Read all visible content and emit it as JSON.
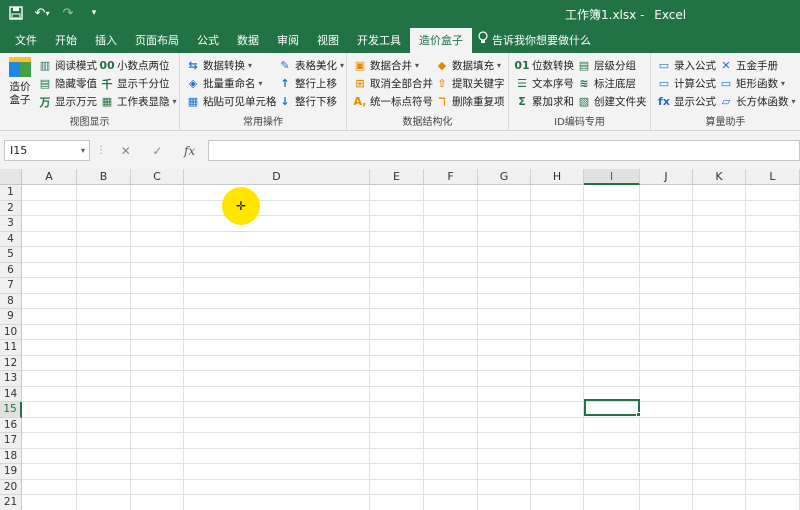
{
  "titlebar": {
    "document": "工作簿1.xlsx",
    "separator": "-",
    "app": "Excel",
    "qat": {
      "save_icon": "save-icon",
      "undo_icon": "undo-icon",
      "redo_icon": "redo-icon",
      "customize_icon": "customize-icon"
    }
  },
  "tabs": [
    "文件",
    "开始",
    "插入",
    "页面布局",
    "公式",
    "数据",
    "审阅",
    "视图",
    "开发工具",
    "造价盒子"
  ],
  "active_tab": "造价盒子",
  "tellme": "告诉我你想要做什么",
  "ribbon": {
    "big_button": {
      "line1": "造价",
      "line2": "盒子"
    },
    "groups": [
      {
        "label": "视图显示",
        "items": [
          "阅读模式",
          "隐藏零值",
          "显示万元",
          "小数点两位",
          "显示千分位",
          "工作表显隐"
        ]
      },
      {
        "label": "常用操作",
        "items": [
          "数据转换",
          "批量重命名",
          "粘贴可见单元格",
          "表格美化",
          "整行上移",
          "整行下移"
        ]
      },
      {
        "label": "数据结构化",
        "items": [
          "数据合并",
          "取消全部合并",
          "统一标点符号",
          "数据填充",
          "提取关键字",
          "删除重复项"
        ]
      },
      {
        "label": "ID编码专用",
        "items": [
          "位数转换",
          "文本序号",
          "累加求和",
          "层级分组",
          "标注底层",
          "创建文件夹"
        ]
      },
      {
        "label": "算量助手",
        "items": [
          "录入公式",
          "计算公式",
          "显示公式",
          "五金手册",
          "矩形函数",
          "长方体函数"
        ]
      }
    ]
  },
  "formula_bar": {
    "name_box": "I15",
    "cancel": "✕",
    "enter": "✓",
    "fx": "fx",
    "formula": ""
  },
  "sheet": {
    "columns": [
      "A",
      "B",
      "C",
      "D",
      "E",
      "F",
      "G",
      "H",
      "I",
      "J",
      "K",
      "L"
    ],
    "rows": [
      "1",
      "2",
      "3",
      "4",
      "5",
      "6",
      "7",
      "8",
      "9",
      "10",
      "11",
      "12",
      "13",
      "14",
      "15",
      "16",
      "17",
      "18",
      "19",
      "20",
      "21"
    ],
    "selected_column": "I",
    "selected_row": "15"
  },
  "colors": {
    "accent": "#217346",
    "pointer": "#ffe600"
  }
}
